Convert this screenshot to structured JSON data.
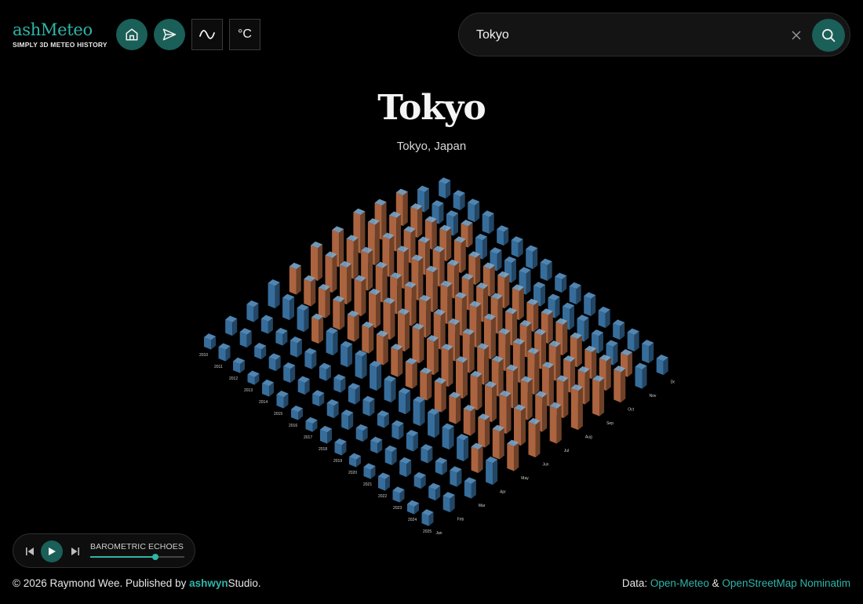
{
  "brand": {
    "name": "ashMeteo",
    "tagline": "SIMPLY 3D METEO HISTORY"
  },
  "toolbar": {
    "home": "home-icon",
    "locate": "paper-plane-icon",
    "mode": "wave-icon",
    "unit_label": "°C"
  },
  "search": {
    "value": "Tokyo",
    "clear": "close-icon",
    "submit": "search-icon"
  },
  "location": {
    "city": "Tokyo",
    "region": "Tokyo, Japan"
  },
  "chart_data": {
    "type": "3d-bar",
    "years": [
      "2010",
      "2011",
      "2012",
      "2013",
      "2014",
      "2015",
      "2016",
      "2017",
      "2018",
      "2019",
      "2020",
      "2021",
      "2022",
      "2023",
      "2024",
      "2025"
    ],
    "months": [
      "Jan",
      "Feb",
      "Mar",
      "Apr",
      "May",
      "Jun",
      "Jul",
      "Aug",
      "Sep",
      "Oct",
      "Nov",
      "Dec"
    ],
    "colors": {
      "high": "#c9764a",
      "low": "#3f80b6"
    }
  },
  "player": {
    "prev": "skip-back-icon",
    "play": "play-icon",
    "next": "skip-forward-icon",
    "track": "BAROMETRIC ECHOES",
    "progress": 0.69
  },
  "footer": {
    "copyright": "© 2026 Raymond Wee. Published by ",
    "publisher_a": "ashwyn",
    "publisher_b": "S",
    "publisher_c": "tudio",
    "period": ".",
    "data_label": "Data: ",
    "source1": "Open-Meteo",
    "amp": " & ",
    "source2": "OpenStreetMap Nominatim"
  }
}
